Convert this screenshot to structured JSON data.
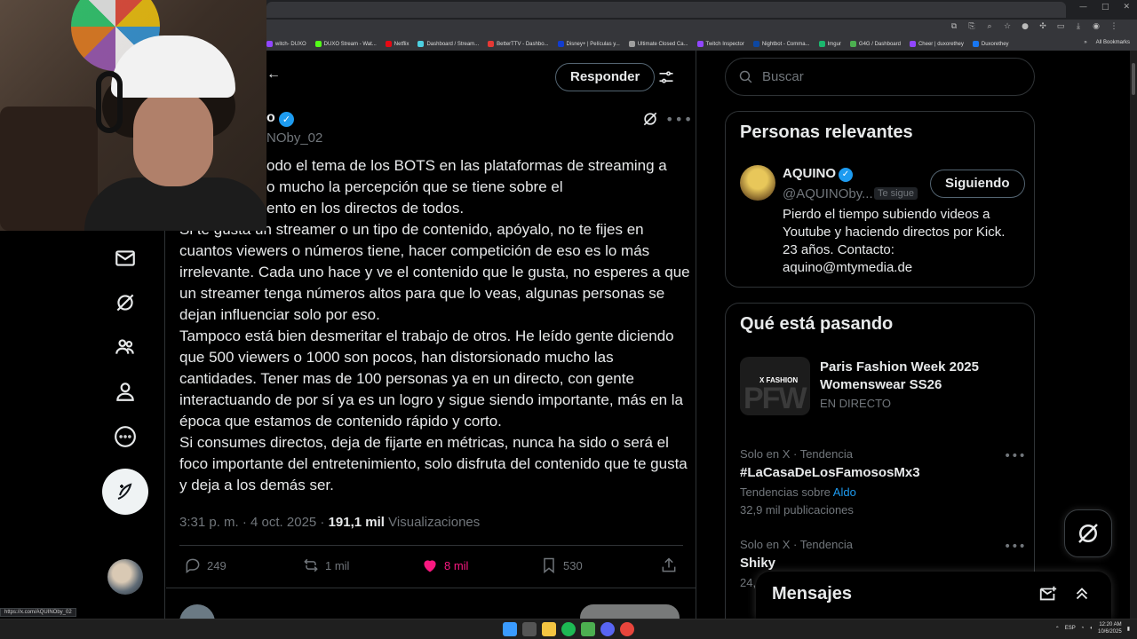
{
  "browser": {
    "bookmarks": [
      {
        "label": "witch- DUXO",
        "color": "#9146ff"
      },
      {
        "label": "DUXO Stream - Wat...",
        "color": "#53fc18"
      },
      {
        "label": "Netflix",
        "color": "#e50914"
      },
      {
        "label": "Dashboard / Stream...",
        "color": "#4dd0e1"
      },
      {
        "label": "BetterTTV - Dashbo...",
        "color": "#e53935"
      },
      {
        "label": "Disney+ | Películas y...",
        "color": "#113ccf"
      },
      {
        "label": "Ultimate Closed Ca...",
        "color": "#9e9e9e"
      },
      {
        "label": "Twitch Inspector",
        "color": "#9146ff"
      },
      {
        "label": "Nightbot - Comma...",
        "color": "#0d47a1"
      },
      {
        "label": "Imgur",
        "color": "#1bb76e"
      },
      {
        "label": "G4G / Dashboard",
        "color": "#4caf50"
      },
      {
        "label": "Cheer | duxorethey",
        "color": "#9146ff"
      },
      {
        "label": "Duxorethey",
        "color": "#1877f2"
      }
    ],
    "all_bookmarks": "All Bookmarks",
    "status_url": "https://x.com/AQUINOby_02"
  },
  "tweet": {
    "reply_label": "Responder",
    "author_name": "o",
    "author_handle": "NOby_02",
    "back_arrow": "←",
    "paragraphs": [
      "odo el tema de los BOTS en las plataformas de streaming a",
      "o mucho la percepción que se tiene sobre el",
      "ento en los directos de todos.",
      "Si te gusta un streamer o un tipo de contenido, apóyalo, no te fijes en cuantos viewers o números tiene, hacer competición de eso es lo más irrelevante. Cada uno hace y ve el contenido que le gusta, no esperes a que un streamer tenga números altos para que lo veas, algunas personas se dejan influenciar solo por eso.",
      "Tampoco está bien desmeritar el trabajo de otros. He leído gente diciendo que 500 viewers o 1000 son pocos, han distorsionado mucho las cantidades. Tener mas de 100 personas ya en un directo, con gente interactuando de por sí ya es un logro y sigue siendo importante, más en la época que estamos de contenido rápido y corto.",
      "Si consumes directos, deja de fijarte en métricas, nunca ha sido o será el foco importante del entretenimiento, solo disfruta del contenido que te gusta y deja a los demás ser."
    ],
    "time": "3:31 p. m. · 4 oct. 2025 · ",
    "views_count": "191,1 mil",
    "views_label": "Visualizaciones",
    "replies": "249",
    "reposts": "1 mil",
    "likes": "8 mil",
    "bookmarks": "530"
  },
  "sidebar": {
    "search_placeholder": "Buscar",
    "relevant": {
      "title": "Personas relevantes",
      "name": "AQUINO",
      "handle": "@AQUINOby...",
      "follows_you": "Te sigue",
      "follow_button": "Siguiendo",
      "bio": "Pierdo el tiempo subiendo videos a Youtube y haciendo directos por Kick. 23 años. Contacto: aquino@mtymedia.de"
    },
    "trends": {
      "title": "Qué está pasando",
      "feature": {
        "thumb_label": "X FASHION",
        "thumb_big": "PFW",
        "title": "Paris Fashion Week 2025 Womenswear SS26",
        "status": "EN DIRECTO"
      },
      "items": [
        {
          "meta": "Solo en X · Tendencia",
          "name": "#LaCasaDeLosFamososMx3",
          "sub_prefix": "Tendencias sobre ",
          "sub_link": "Aldo",
          "count": "32,9 mil publicaciones"
        },
        {
          "meta": "Solo en X · Tendencia",
          "name": "Shiky",
          "count": "24,"
        }
      ]
    },
    "messages_title": "Mensajes"
  },
  "taskbar": {
    "lang": "ESP",
    "time": "12:20 AM",
    "date": "10/6/2025"
  }
}
